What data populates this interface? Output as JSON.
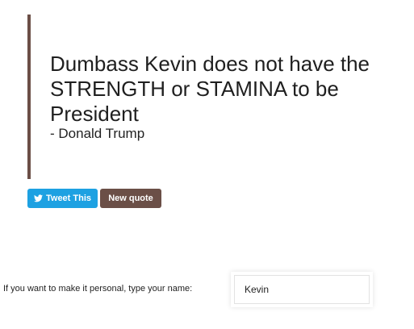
{
  "quote": {
    "text": "Dumbass Kevin does not have the STRENGTH or STAMINA to be President",
    "author": "- Donald Trump"
  },
  "buttons": {
    "tweet_label": "Tweet This",
    "new_quote_label": "New quote"
  },
  "personalize": {
    "label": "If you want to make it personal, type your name:",
    "name_value": "Kevin"
  },
  "colors": {
    "accent": "#6b4f47",
    "twitter": "#1da1e2"
  },
  "icons": {
    "tweet": "twitter-bird-icon"
  }
}
